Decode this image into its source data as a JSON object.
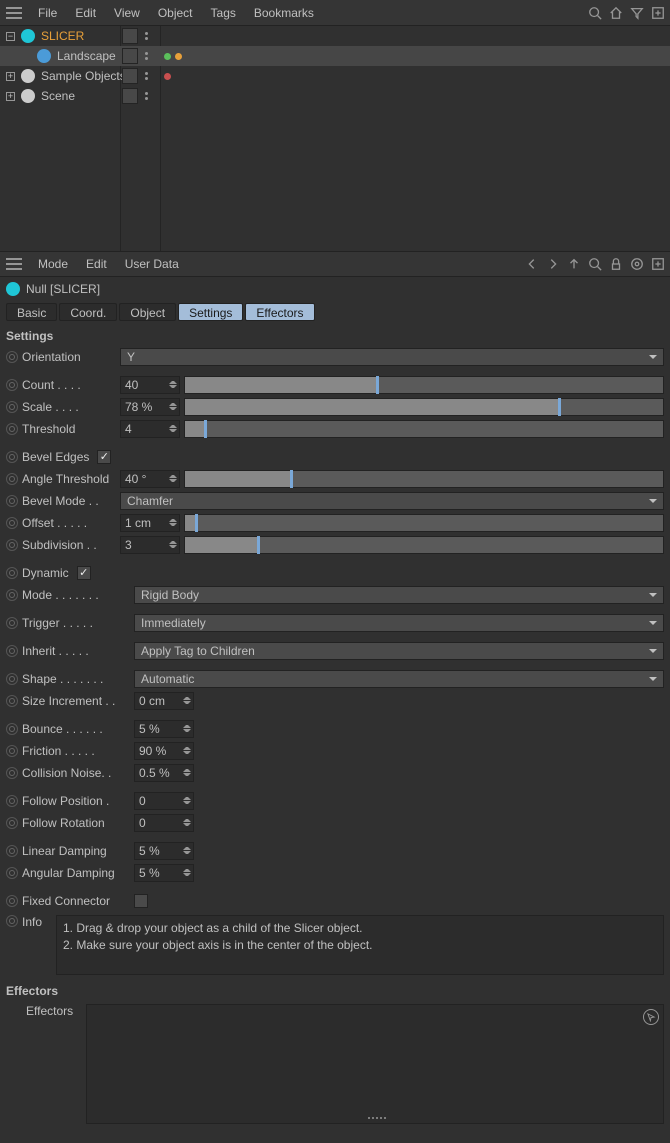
{
  "topMenu": {
    "items": [
      "File",
      "Edit",
      "View",
      "Object",
      "Tags",
      "Bookmarks"
    ]
  },
  "outliner": {
    "rows": [
      {
        "label": "SLICER",
        "icon": "#1fc6d6",
        "depth": 0,
        "expand": "−",
        "sel": true,
        "tags": []
      },
      {
        "label": "Landscape",
        "icon": "#4b9bd8",
        "depth": 1,
        "expand": "",
        "sel": false,
        "tags": [
          "#5bbf5b",
          "#e8a03a"
        ],
        "bg": "#464646"
      },
      {
        "label": "Sample Objects",
        "icon": "#cccccc",
        "depth": 0,
        "expand": "+",
        "sel": false,
        "tags": [
          "#c94f4f"
        ]
      },
      {
        "label": "Scene",
        "icon": "#cccccc",
        "depth": 0,
        "expand": "+",
        "sel": false,
        "tags": []
      }
    ]
  },
  "subMenu": {
    "items": [
      "Mode",
      "Edit",
      "User Data"
    ]
  },
  "object": {
    "title": "Null [SLICER]"
  },
  "tabs": [
    "Basic",
    "Coord.",
    "Object",
    "Settings",
    "Effectors"
  ],
  "activeTab": 3,
  "sections": {
    "settings": "Settings",
    "effectors": "Effectors"
  },
  "params": {
    "orientation": {
      "label": "Orientation",
      "value": "Y"
    },
    "count": {
      "label": "Count . . . .",
      "value": "40",
      "fill": 40
    },
    "scale": {
      "label": "Scale  . . . .",
      "value": "78 %",
      "fill": 78
    },
    "threshold": {
      "label": "Threshold",
      "value": "4",
      "fill": 4
    },
    "bevelEdges": {
      "label": "Bevel Edges",
      "checked": true
    },
    "angleThreshold": {
      "label": "Angle Threshold",
      "value": "40 °",
      "fill": 22
    },
    "bevelMode": {
      "label": "Bevel Mode . .",
      "value": "Chamfer"
    },
    "offset": {
      "label": "Offset . . . . .",
      "value": "1 cm",
      "fill": 1.5
    },
    "subdivision": {
      "label": "Subdivision  . .",
      "value": "3",
      "fill": 15
    },
    "dynamic": {
      "label": "Dynamic",
      "checked": true
    },
    "mode": {
      "label": "Mode . . . . . . .",
      "value": "Rigid Body"
    },
    "trigger": {
      "label": "Trigger  . . . . .",
      "value": "Immediately"
    },
    "inherit": {
      "label": "Inherit  . . . . .",
      "value": "Apply Tag to Children"
    },
    "shape": {
      "label": "Shape . . . . . . .",
      "value": "Automatic"
    },
    "sizeIncrement": {
      "label": "Size Increment . .",
      "value": "0 cm"
    },
    "bounce": {
      "label": "Bounce . . . . . .",
      "value": "5 %"
    },
    "friction": {
      "label": "Friction . . . . .",
      "value": "90 %"
    },
    "collisionNoise": {
      "label": "Collision Noise. .",
      "value": "0.5 %"
    },
    "followPosition": {
      "label": "Follow Position  .",
      "value": "0"
    },
    "followRotation": {
      "label": "Follow Rotation",
      "value": "0"
    },
    "linearDamping": {
      "label": "Linear Damping",
      "value": "5 %"
    },
    "angularDamping": {
      "label": "Angular Damping",
      "value": "5 %"
    },
    "fixedConnector": {
      "label": "Fixed Connector",
      "checked": false
    },
    "info": {
      "label": "Info",
      "value": "1. Drag & drop your object as a child of the Slicer object.\n2. Make sure your object axis is in the center of the object."
    },
    "effectors": {
      "label": "Effectors"
    }
  }
}
